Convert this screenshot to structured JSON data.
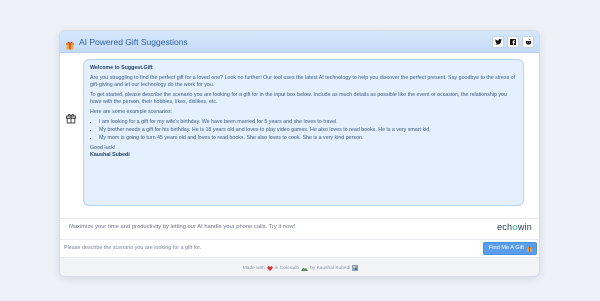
{
  "header": {
    "title": "AI Powered Gift Suggestions",
    "social_icons": [
      "twitter-icon",
      "facebook-icon",
      "reddit-icon"
    ]
  },
  "message": {
    "welcome": "Welcome to Suggest.Gift",
    "intro": "Are you struggling to find the perfect gift for a loved one? Look no further! Our tool uses the latest AI technology to help you discover the perfect present. Say goodbye to the stress of gift-giving and let our technology do the work for you.",
    "instructions": "To get started, please describe the scenario you are looking for a gift for in the input box below. Include as much details as possible like the event or occasion, the relationship you have with the person, their hobbies, likes, dislikes, etc.",
    "examples_heading": "Here are some example scenarios:",
    "examples": [
      "I am looking for a gift for my wife's birthday. We have been married for 5 years and she loves to travel.",
      "My brother needs a gift for his birthday. He is 18 years old and loves to play video games. He also loves to read books. He is a very smart kid.",
      "My mom is going to turn 45 years old and loves to read books. She also loves to cook. She is a very kind person."
    ],
    "sign_off": "Good luck!",
    "author": "Kaushal Subedi"
  },
  "promo": {
    "text": "Maximize your time and productivity by letting our AI handle your phone calls. Try it now!",
    "brand_prefix": "ech",
    "brand_o": "o",
    "brand_suffix": "win"
  },
  "input": {
    "placeholder": "Please describe the scenario you are looking for a gift for.",
    "value": ""
  },
  "find_button": {
    "label": "Find Me A Gift"
  },
  "footer": {
    "made_with": "Made with",
    "in_colorado": "in Colorado",
    "by": "by Kaushal Subedi"
  },
  "colors": {
    "accent": "#5b9ded",
    "bubble_bg": "#e4f0fe",
    "header_bg": "#d6e7fb",
    "heart": "#d9343a"
  }
}
